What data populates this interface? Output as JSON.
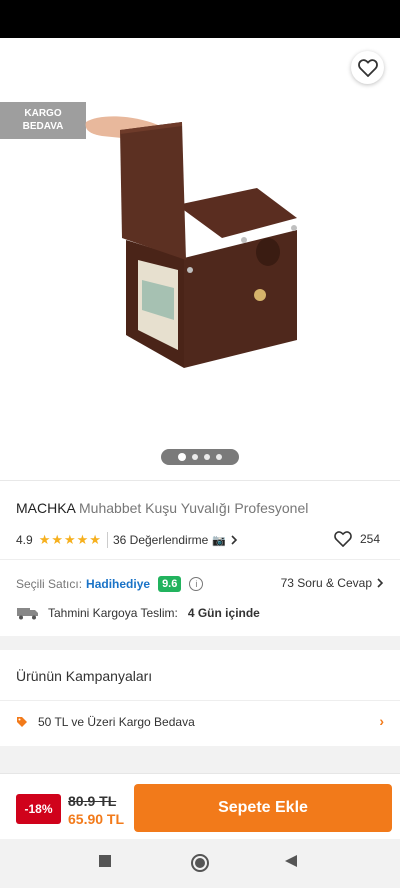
{
  "colors": {
    "accent": "#f27a1a",
    "discount": "#d0021b",
    "seller": "#1a73c7",
    "score": "#22b35e",
    "stars": "#f6b01e"
  },
  "badge": {
    "line1": "KARGO",
    "line2": "BEDAVA"
  },
  "gallery": {
    "total": 4,
    "active": 1
  },
  "product": {
    "brand": "MACHKA",
    "name": "Muhabbet Kuşu Yuvalığı Profesyonel",
    "rating": "4.9",
    "stars": "★★★★★",
    "reviews": "36 Değerlendirme",
    "reviews_icon": "📷",
    "likes": "254"
  },
  "seller": {
    "label": "Seçili Satıcı:",
    "name": "Hadihediye",
    "score": "9.6",
    "qa": "73 Soru & Cevap"
  },
  "delivery": {
    "label": "Tahmini Kargoya Teslim:",
    "value": "4 Gün içinde"
  },
  "campaigns": {
    "title": "Ürünün Kampanyaları",
    "item": "50 TL ve Üzeri Kargo Bedava"
  },
  "cart": {
    "discount": "-18%",
    "old_price": "80.9 TL",
    "new_price": "65.90 TL",
    "button": "Sepete Ekle"
  },
  "icons": {
    "back": "arrow-left-icon",
    "share": "share-icon",
    "favorite": "heart-icon",
    "info": "info-icon",
    "truck": "truck-icon",
    "tag": "tag-icon",
    "nav_recent": "square-icon",
    "nav_home": "circle-icon",
    "nav_back": "triangle-back-icon"
  }
}
